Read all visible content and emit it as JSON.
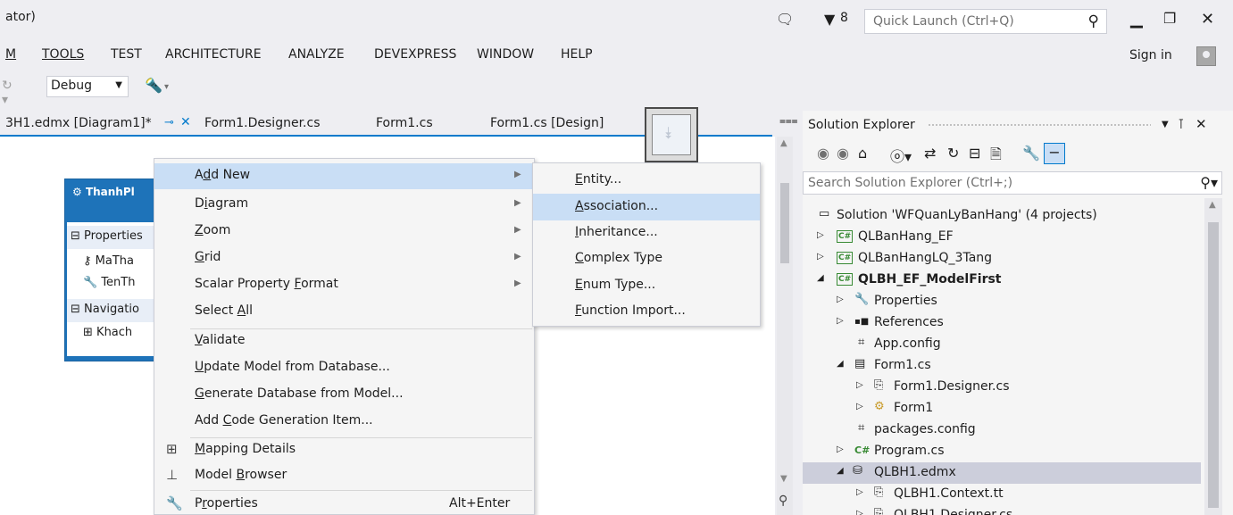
{
  "window": {
    "title_fragment": "ator)",
    "notify_count": "8",
    "quick_launch_placeholder": "Quick Launch (Ctrl+Q)"
  },
  "menubar": {
    "items": [
      {
        "label": "M",
        "underline": "M",
        "name": "menu-team"
      },
      {
        "label": "TOOLS"
      },
      {
        "label": "TEST"
      },
      {
        "label": "ARCHITECTURE"
      },
      {
        "label": "ANALYZE"
      },
      {
        "label": "DEVEXPRESS"
      },
      {
        "label": "WINDOW"
      },
      {
        "label": "HELP"
      }
    ],
    "sign_in": "Sign in"
  },
  "toolbar": {
    "config_value": "Debug"
  },
  "tabs": {
    "active": "3H1.edmx [Diagram1]*",
    "others": [
      "Form1.Designer.cs",
      "Form1.cs",
      "Form1.cs [Design]"
    ]
  },
  "entity": {
    "title": "ThanhPl",
    "properties_header": "Properties",
    "prop1": "MaTha",
    "prop2": "TenTh",
    "navigation_header": "Navigatio",
    "nav1": "Khach"
  },
  "context_menu": {
    "items": [
      {
        "label": "Add New",
        "submenu": true,
        "highlight": true
      },
      {
        "label": "Diagram",
        "submenu": true
      },
      {
        "label": "Zoom",
        "submenu": true
      },
      {
        "label": "Grid",
        "submenu": true
      },
      {
        "label": "Scalar Property Format",
        "submenu": true
      },
      {
        "label": "Select All"
      },
      {
        "label": "Validate"
      },
      {
        "label": "Update Model from Database..."
      },
      {
        "label": "Generate Database from Model..."
      },
      {
        "label": "Add Code Generation Item..."
      },
      {
        "label": "Mapping Details",
        "icon": "mapping-details-icon"
      },
      {
        "label": "Model Browser",
        "icon": "model-browser-icon"
      },
      {
        "label": "Properties",
        "icon": "wrench-icon",
        "shortcut": "Alt+Enter"
      }
    ]
  },
  "submenu": {
    "items": [
      {
        "label": "Entity..."
      },
      {
        "label": "Association...",
        "highlight": true
      },
      {
        "label": "Inheritance..."
      },
      {
        "label": "Complex Type"
      },
      {
        "label": "Enum Type..."
      },
      {
        "label": "Function Import..."
      }
    ]
  },
  "solution_explorer": {
    "title": "Solution Explorer",
    "search_placeholder": "Search Solution Explorer (Ctrl+;)",
    "tree": [
      {
        "label": "Solution 'WFQuanLyBanHang' (4 projects)"
      },
      {
        "label": "QLBanHang_EF"
      },
      {
        "label": "QLBanHangLQ_3Tang"
      },
      {
        "label": "QLBH_EF_ModelFirst"
      },
      {
        "label": "Properties"
      },
      {
        "label": "References"
      },
      {
        "label": "App.config"
      },
      {
        "label": "Form1.cs"
      },
      {
        "label": "Form1.Designer.cs"
      },
      {
        "label": "Form1"
      },
      {
        "label": "packages.config"
      },
      {
        "label": "Program.cs"
      },
      {
        "label": "QLBH1.edmx",
        "selected": true
      },
      {
        "label": "QLBH1.Context.tt"
      },
      {
        "label": "QLBH1.Designer.cs"
      }
    ]
  },
  "colors": {
    "accent": "#007acc",
    "entity_header": "#1e73b9",
    "menu_highlight": "#c9def5",
    "selection": "#cccedb"
  }
}
